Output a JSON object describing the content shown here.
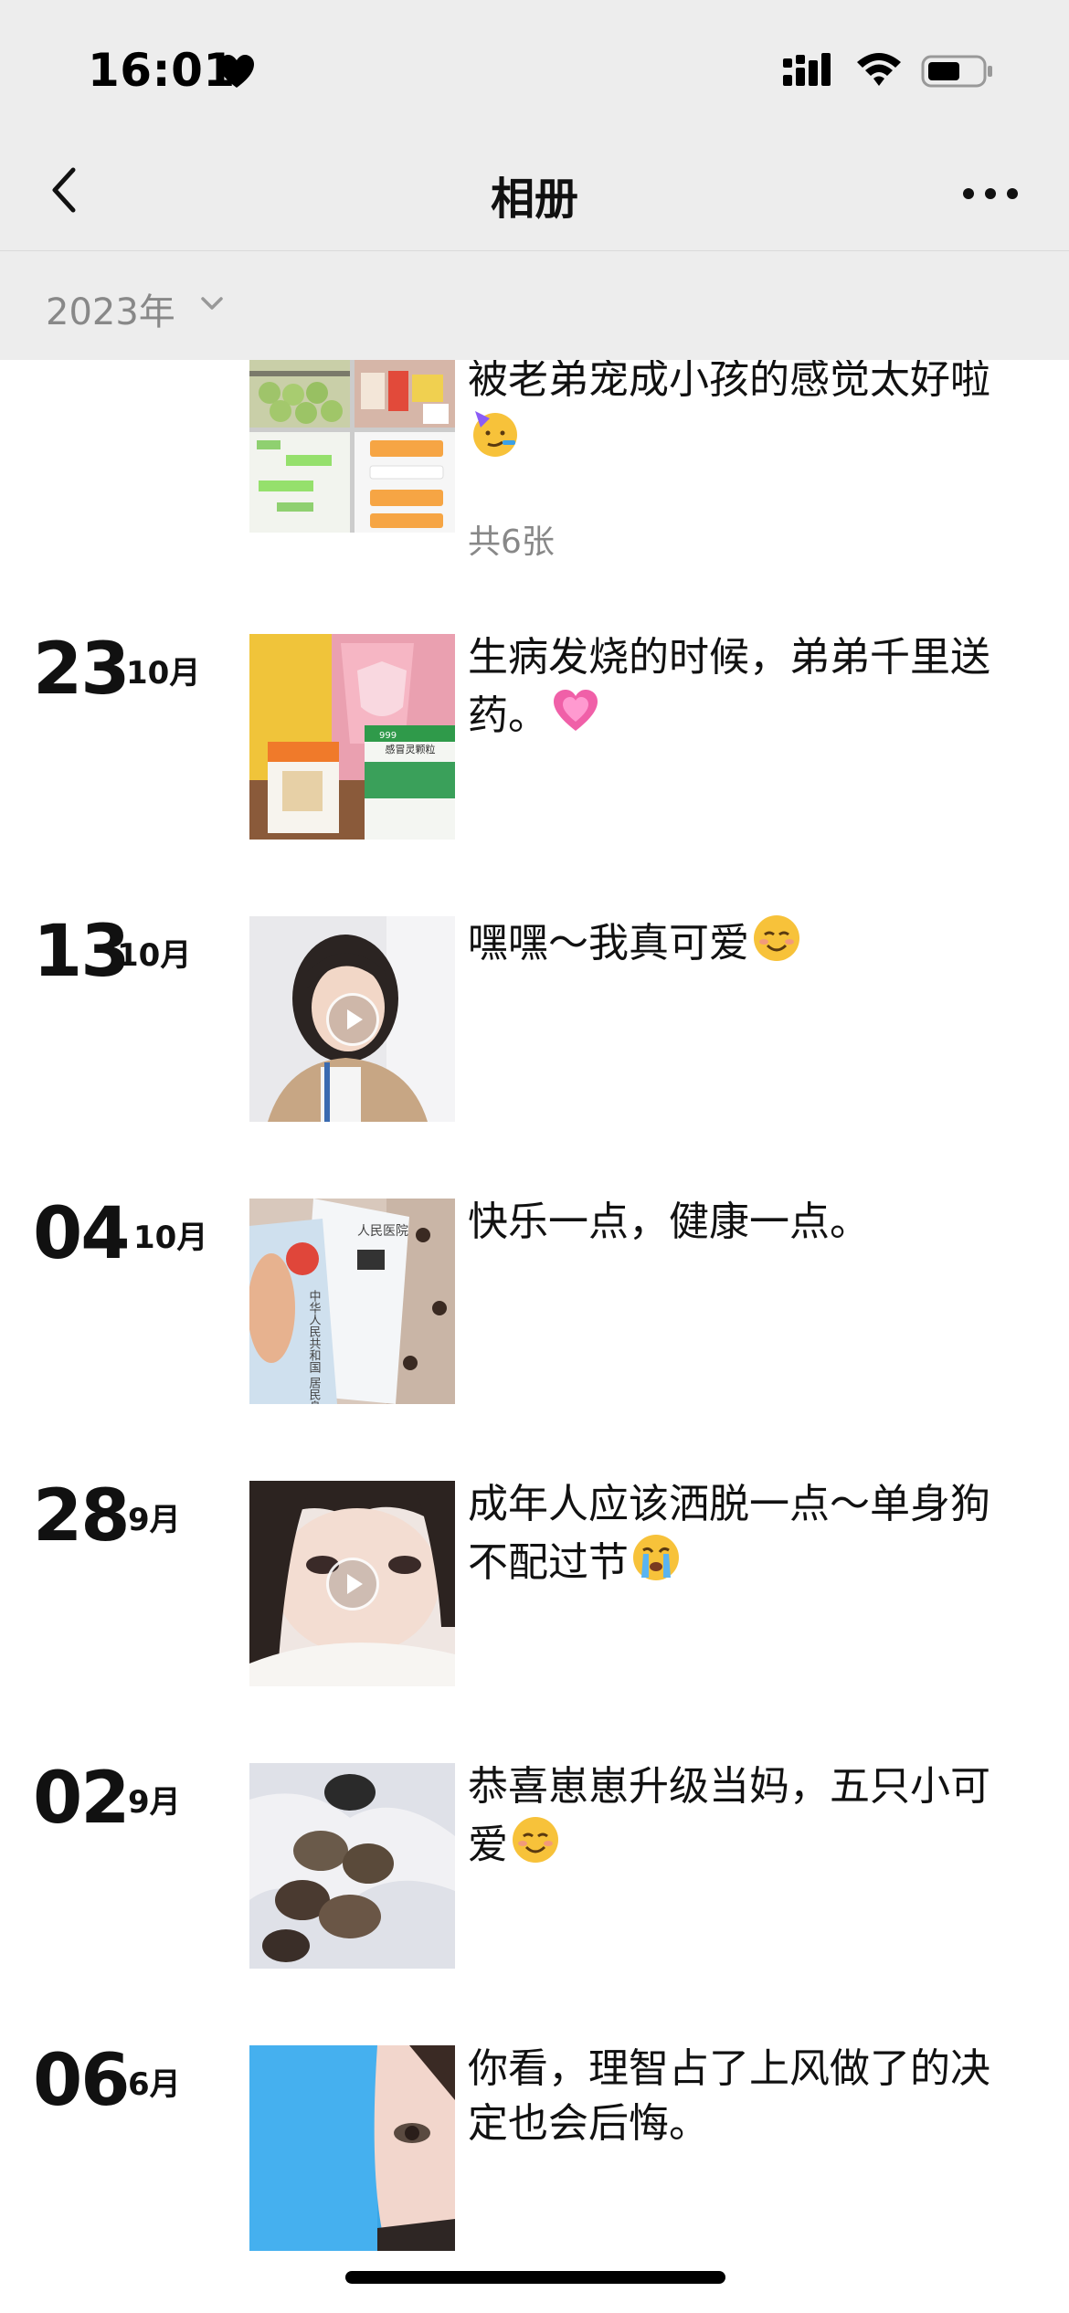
{
  "status_bar": {
    "time": "16:01"
  },
  "nav": {
    "title": "相册"
  },
  "year_filter": {
    "label": "2023年"
  },
  "entries": [
    {
      "day": "",
      "month": "",
      "caption": "被老弟宠成小孩的感觉太好啦",
      "photo_count": "共6张",
      "emoji": "party-face"
    },
    {
      "day": "23",
      "month": "10月",
      "caption": "生病发烧的时候，弟弟千里送药。",
      "emoji": "heart"
    },
    {
      "day": "13",
      "month": "10月",
      "caption": "嘿嘿～我真可爱",
      "emoji": "smile",
      "video": true
    },
    {
      "day": "04",
      "month": "10月",
      "caption": "快乐一点，健康一点。"
    },
    {
      "day": "28",
      "month": "9月",
      "caption": "成年人应该洒脱一点～单身狗不配过节",
      "emoji": "crying-face",
      "video": true
    },
    {
      "day": "02",
      "month": "9月",
      "caption": "恭喜崽崽升级当妈，五只小可爱",
      "emoji": "smile"
    },
    {
      "day": "06",
      "month": "6月",
      "caption": "你看，理智占了上风做了的决定也会后悔。"
    }
  ],
  "thumb_text": {
    "box_label": "感冒灵颗粒",
    "id_card_text": "中华人民共和国 居民身份证",
    "hospital": "人民医院"
  },
  "colors": {
    "header_bg": "#ededed",
    "secondary_text": "#888888",
    "text": "#111111"
  }
}
